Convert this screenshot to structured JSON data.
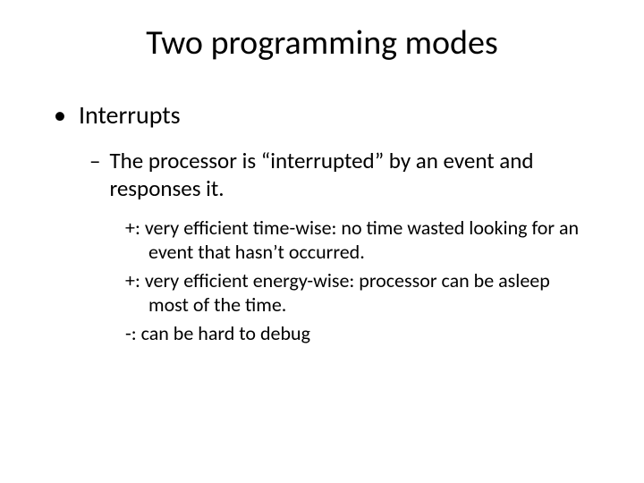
{
  "slide": {
    "title": "Two programming modes",
    "bullet1": "Interrupts",
    "sub1_line1": "The processor is “interrupted” by an event and",
    "sub1_line2": "responses it.",
    "point1_line1": "+: very efficient time-wise: no time wasted looking for an",
    "point1_line2": "event that hasn’t occurred.",
    "point2_line1": "+: very efficient energy-wise: processor can be asleep",
    "point2_line2": "most of the time.",
    "point3_line1": "-: can be hard to debug"
  }
}
